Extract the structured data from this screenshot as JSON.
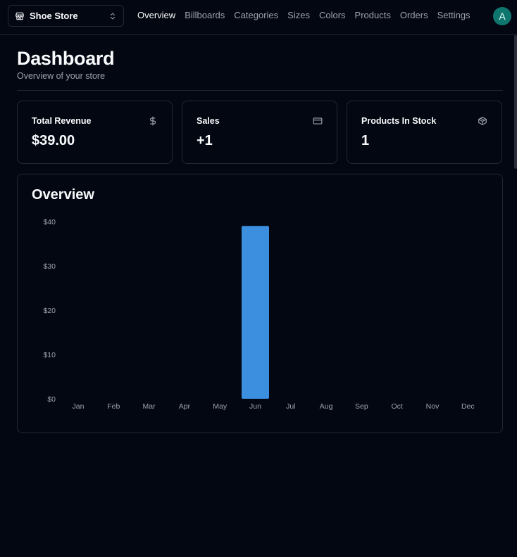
{
  "store_switcher": {
    "label": "Shoe Store"
  },
  "nav": [
    {
      "label": "Overview",
      "active": true
    },
    {
      "label": "Billboards",
      "active": false
    },
    {
      "label": "Categories",
      "active": false
    },
    {
      "label": "Sizes",
      "active": false
    },
    {
      "label": "Colors",
      "active": false
    },
    {
      "label": "Products",
      "active": false
    },
    {
      "label": "Orders",
      "active": false
    },
    {
      "label": "Settings",
      "active": false
    }
  ],
  "avatar": {
    "initial": "A",
    "color": "#0f766e"
  },
  "page": {
    "title": "Dashboard",
    "subtitle": "Overview of your store"
  },
  "cards": [
    {
      "title": "Total Revenue",
      "value": "$39.00",
      "icon": "dollar-icon"
    },
    {
      "title": "Sales",
      "value": "+1",
      "icon": "credit-card-icon"
    },
    {
      "title": "Products In Stock",
      "value": "1",
      "icon": "package-icon"
    }
  ],
  "overview": {
    "title": "Overview"
  },
  "chart_data": {
    "type": "bar",
    "categories": [
      "Jan",
      "Feb",
      "Mar",
      "Apr",
      "May",
      "Jun",
      "Jul",
      "Aug",
      "Sep",
      "Oct",
      "Nov",
      "Dec"
    ],
    "values": [
      0,
      0,
      0,
      0,
      0,
      39,
      0,
      0,
      0,
      0,
      0,
      0
    ],
    "y_ticks": [
      "$0",
      "$10",
      "$20",
      "$30",
      "$40"
    ],
    "ylim": [
      0,
      40
    ],
    "bar_color": "#3b8fde",
    "grid": false
  }
}
